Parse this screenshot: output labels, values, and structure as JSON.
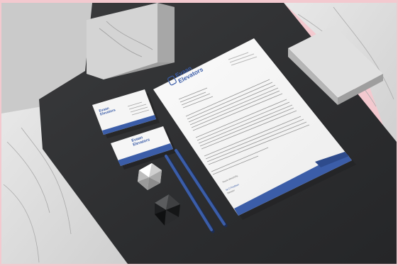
{
  "scene": {
    "description_tag": "stationery-mockup",
    "colors": {
      "frame": "#f3c9cf",
      "table": "#2e2f31",
      "marble": "#d9d9d9",
      "brand_blue": "#3b5da8",
      "paper": "#f7f7f7"
    }
  },
  "brand": {
    "line1": "Evaan",
    "line2": "Elevators",
    "logo_icon": "elevator-logo-icon"
  },
  "letterhead": {
    "signoff": "Yours sincerely,",
    "signature_name": "M.C.Pradhan",
    "signature_title": "Director"
  }
}
